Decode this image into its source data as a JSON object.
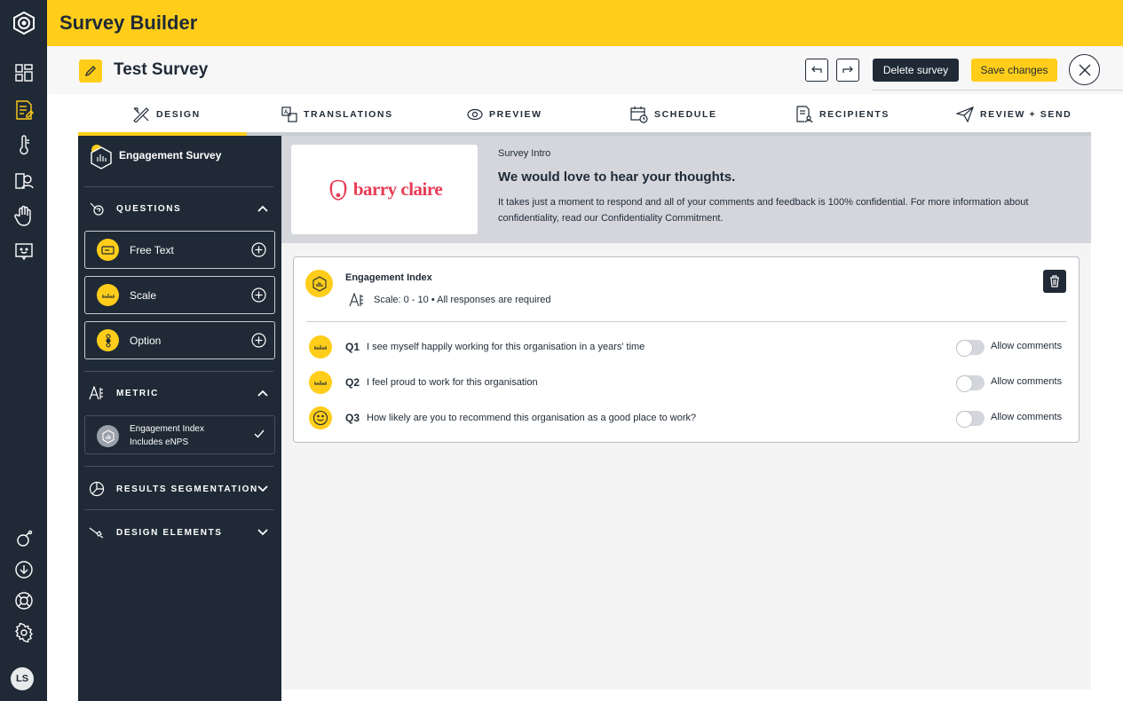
{
  "app": {
    "title": "Survey Builder",
    "avatar_initials": "LS"
  },
  "rail": {
    "top_icons": [
      "dashboard-icon",
      "survey-icon",
      "thermometer-icon",
      "person-card-icon",
      "hand-icon",
      "feedback-icon"
    ],
    "bottom_icons": [
      "nudge-icon",
      "download-icon",
      "help-lifebuoy-icon",
      "settings-gear-icon"
    ]
  },
  "survey": {
    "name": "Test Survey",
    "delete_label": "Delete survey",
    "save_label": "Save changes"
  },
  "tabs": [
    {
      "label": "DESIGN",
      "icon": "design-icon",
      "active": true
    },
    {
      "label": "TRANSLATIONS",
      "icon": "translate-icon"
    },
    {
      "label": "PREVIEW",
      "icon": "eye-icon"
    },
    {
      "label": "SCHEDULE",
      "icon": "calendar-icon"
    },
    {
      "label": "RECIPIENTS",
      "icon": "recipients-icon"
    },
    {
      "label": "REVIEW + SEND",
      "icon": "send-icon"
    }
  ],
  "panel": {
    "title": "Engagement Survey",
    "questions_label": "QUESTIONS",
    "question_types": [
      {
        "label": "Free Text",
        "icon": "text-field-icon"
      },
      {
        "label": "Scale",
        "icon": "ruler-icon"
      },
      {
        "label": "Option",
        "icon": "options-icon"
      }
    ],
    "metric_label": "METRIC",
    "metric": {
      "name": "Engagement Index",
      "sub": "Includes eNPS"
    },
    "segmentation_label": "RESULTS SEGMENTATION",
    "design_elements_label": "DESIGN ELEMENTS"
  },
  "intro": {
    "brand": "barry claire",
    "label": "Survey Intro",
    "heading": "We would love to hear your thoughts.",
    "body": "It takes just a moment to respond and all of your comments and feedback is 100% confidential. For more information about confidentiality, read our Confidentiality Commitment."
  },
  "card": {
    "title": "Engagement Index",
    "subtitle": "Scale: 0 - 10 • All responses are required",
    "questions": [
      {
        "num": "Q1",
        "text": "I see myself happily working for this organisation in a years' time",
        "toggle": "Allow comments",
        "icon": "ruler-icon"
      },
      {
        "num": "Q2",
        "text": "I feel proud to work for this organisation",
        "toggle": "Allow comments",
        "icon": "ruler-icon"
      },
      {
        "num": "Q3",
        "text": "How likely are you to recommend this organisation as a good place to work?",
        "toggle": "Allow comments",
        "icon": "smiley-icon"
      }
    ]
  },
  "colors": {
    "accent": "#ffcd1a",
    "navy": "#1f2a36",
    "brand": "#e63b54"
  }
}
